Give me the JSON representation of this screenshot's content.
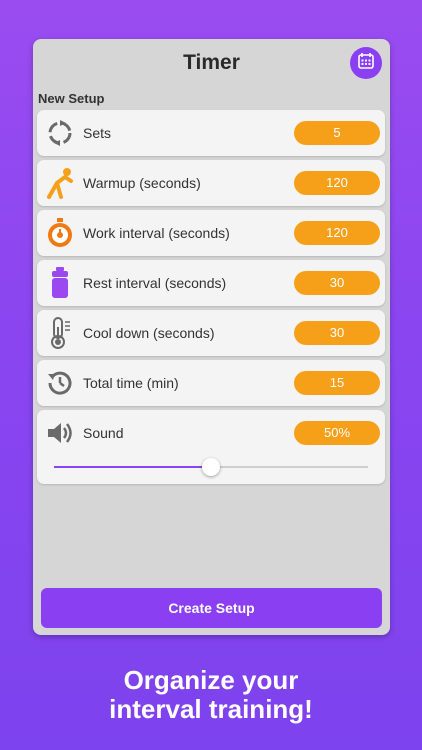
{
  "header": {
    "title": "Timer",
    "calendar_icon": "calendar-icon",
    "accent_color": "#8a3ff2"
  },
  "section": {
    "label": "New Setup"
  },
  "rows": [
    {
      "icon": "repeat-icon",
      "label": "Sets",
      "value": "5"
    },
    {
      "icon": "stretch-icon",
      "label": "Warmup (seconds)",
      "value": "120"
    },
    {
      "icon": "stopwatch-icon",
      "label": "Work interval (seconds)",
      "value": "120"
    },
    {
      "icon": "water-bottle-icon",
      "label": "Rest interval (seconds)",
      "value": "30"
    },
    {
      "icon": "thermometer-icon",
      "label": "Cool down (seconds)",
      "value": "30"
    },
    {
      "icon": "history-clock-icon",
      "label": "Total time (min)",
      "value": "15"
    }
  ],
  "sound": {
    "icon": "speaker-icon",
    "label": "Sound",
    "value": "50%",
    "level": 0.5
  },
  "actions": {
    "create_label": "Create Setup"
  },
  "tagline": {
    "line1": "Organize your",
    "line2": "interval training!"
  },
  "colors": {
    "pill": "#f6a01a",
    "background": "#8a45f0",
    "card": "#d6d6d6"
  }
}
